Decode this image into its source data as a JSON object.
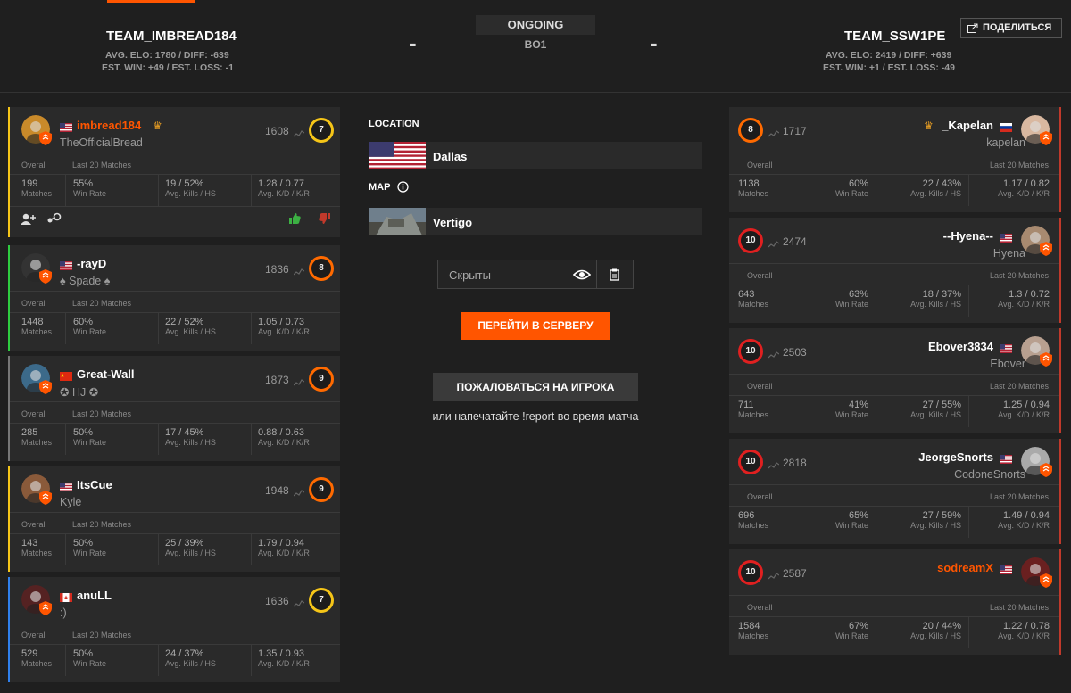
{
  "header": {
    "status": "ONGOING",
    "format": "BO1",
    "left_score": "-",
    "right_score": "-",
    "share_label": "ПОДЕЛИТЬСЯ",
    "team1": {
      "name": "TEAM_IMBREAD184",
      "line1": "AVG. ELO: 1780 / DIFF: -639",
      "line2": "EST. WIN: +49 / EST. LOSS: -1"
    },
    "team2": {
      "name": "TEAM_SSW1PE",
      "line1": "AVG. ELO: 2419 / DIFF: +639",
      "line2": "EST. WIN: +1 / EST. LOSS: -49"
    }
  },
  "labels": {
    "overall": "Overall",
    "last20": "Last 20 Matches",
    "matches": "Matches",
    "winrate": "Win Rate",
    "kills": "Avg. Kills / HS",
    "kd": "Avg. K/D / K/R"
  },
  "left_players": [
    {
      "name": "imbread184",
      "nick": "TheOfficialBread",
      "elo": "1608",
      "level": "7",
      "matches": "199",
      "winrate": "55%",
      "kills": "19 / 52%",
      "kd": "1.28 / 0.77"
    },
    {
      "name": "-rayD",
      "nick": "♠ Spade ♠",
      "elo": "1836",
      "level": "8",
      "matches": "1448",
      "winrate": "60%",
      "kills": "22 / 52%",
      "kd": "1.05 / 0.73"
    },
    {
      "name": "Great-Wall",
      "nick": "✪ HJ ✪",
      "elo": "1873",
      "level": "9",
      "matches": "285",
      "winrate": "50%",
      "kills": "17 / 45%",
      "kd": "0.88 / 0.63"
    },
    {
      "name": "ItsCue",
      "nick": "Kyle",
      "elo": "1948",
      "level": "9",
      "matches": "143",
      "winrate": "50%",
      "kills": "25 / 39%",
      "kd": "1.79 / 0.94"
    },
    {
      "name": "anuLL",
      "nick": ":)",
      "elo": "1636",
      "level": "7",
      "matches": "529",
      "winrate": "50%",
      "kills": "24 / 37%",
      "kd": "1.35 / 0.93"
    }
  ],
  "right_players": [
    {
      "name": "_Kapelan",
      "nick": "kapelan",
      "elo": "1717",
      "level": "8",
      "matches": "1138",
      "winrate": "60%",
      "kills": "22 / 43%",
      "kd": "1.17 / 0.82"
    },
    {
      "name": "--Hyena--",
      "nick": "Hyena",
      "elo": "2474",
      "level": "10",
      "matches": "643",
      "winrate": "63%",
      "kills": "18 / 37%",
      "kd": "1.3 / 0.72"
    },
    {
      "name": "Ebover3834",
      "nick": "Ebover",
      "elo": "2503",
      "level": "10",
      "matches": "711",
      "winrate": "41%",
      "kills": "27 / 55%",
      "kd": "1.25 / 0.94"
    },
    {
      "name": "JeorgeSnorts",
      "nick": "CodoneSnorts",
      "elo": "2818",
      "level": "10",
      "matches": "696",
      "winrate": "65%",
      "kills": "27 / 59%",
      "kd": "1.49 / 0.94"
    },
    {
      "name": "sodreamX",
      "nick": "",
      "elo": "2587",
      "level": "10",
      "matches": "1584",
      "winrate": "67%",
      "kills": "20 / 44%",
      "kd": "1.22 / 0.78"
    }
  ],
  "center": {
    "location_label": "LOCATION",
    "location_value": "Dallas",
    "map_label": "MAP",
    "map_value": "Vertigo",
    "password_value": "Скрыты",
    "connect_label": "ПЕРЕЙТИ В СЕРВЕРУ",
    "report_label": "ПОЖАЛОВАТЬСЯ НА ИГРОКА",
    "report_hint": "или напечатайте !report во время матча"
  },
  "colors": {
    "accent": "#ff5500",
    "left_bars": [
      "#f5c518",
      "#2ecc40",
      "#777777",
      "#f5c518",
      "#2f80ed"
    ],
    "right_bar": "#c0392b"
  }
}
